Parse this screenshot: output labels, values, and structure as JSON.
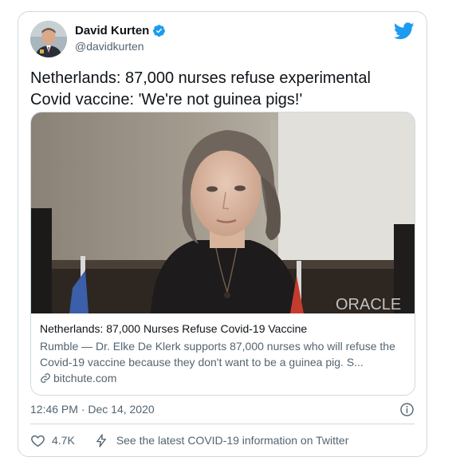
{
  "author": {
    "display_name": "David Kurten",
    "handle": "@davidkurten",
    "verified": true
  },
  "tweet": {
    "text": "Netherlands: 87,000 nurses refuse experimental Covid vaccine: 'We're not guinea pigs!'"
  },
  "card": {
    "image_watermark": "ORACLE",
    "title": "Netherlands: 87,000 Nurses Refuse Covid-19 Vaccine",
    "description": "Rumble — Dr. Elke De Klerk supports 87,000 nurses who will refuse the Covid-19 vaccine because they don't want to be a guinea pig. S...",
    "domain": "bitchute.com"
  },
  "meta": {
    "timestamp": "12:46 PM · Dec 14, 2020"
  },
  "actions": {
    "like_count": "4.7K",
    "covid_info_label": "See the latest COVID-19 information on Twitter"
  },
  "colors": {
    "twitter_blue": "#1d9bf0",
    "secondary_text": "#536471",
    "border": "#cfd9de"
  },
  "icons": [
    "verified-badge-icon",
    "twitter-bird-icon",
    "link-icon",
    "info-icon",
    "heart-icon",
    "lightning-bolt-icon"
  ]
}
